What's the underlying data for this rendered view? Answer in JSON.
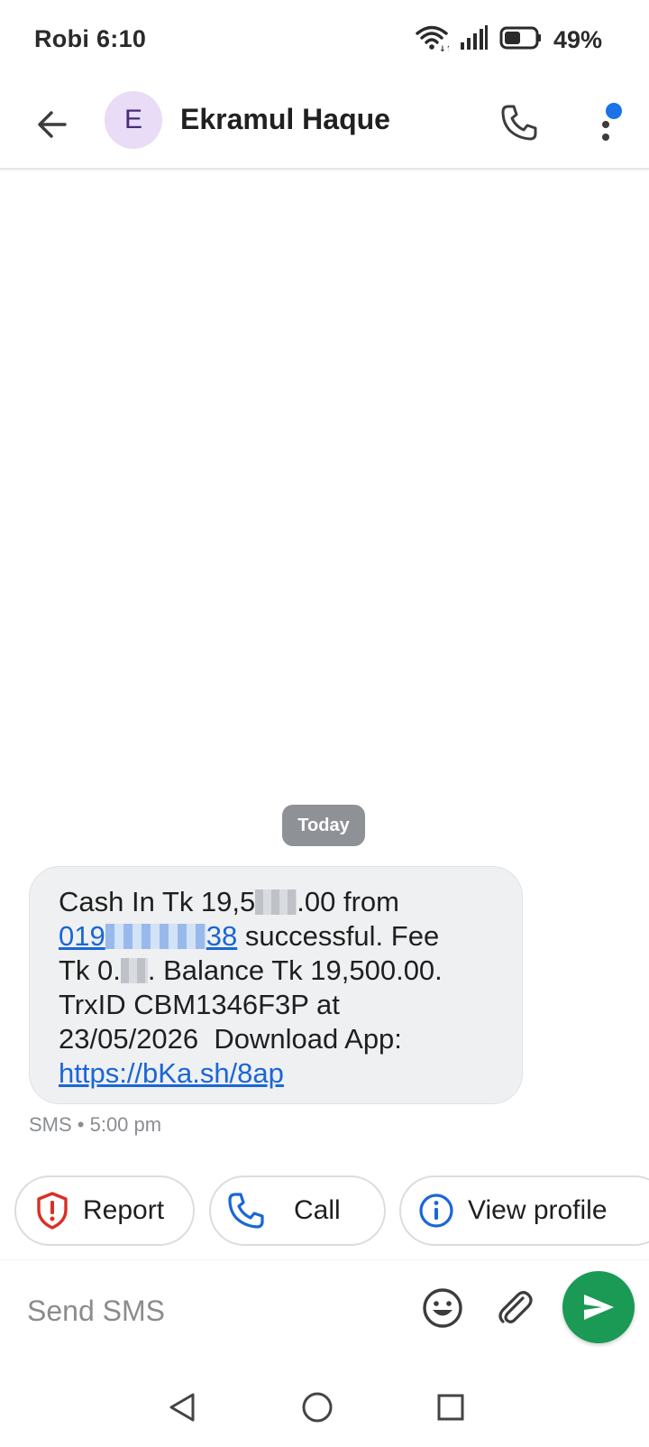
{
  "status_bar": {
    "carrier_time": "Robi 6:10",
    "battery_percent": "49%",
    "battery_level": 0.49,
    "icons": [
      "wifi-icon",
      "signal-icon",
      "battery-icon"
    ]
  },
  "app_bar": {
    "back_icon": "arrow-back-icon",
    "avatar_letter": "E",
    "contact_name": "Ekramul Haque",
    "call_icon": "phone-icon",
    "more_icon": "more-vert-icon",
    "notification_dot_color": "#1a73e8"
  },
  "conversation": {
    "date_label": "Today",
    "message": {
      "line1_a": "Cash In Tk 19,5",
      "line1_b": ".00 from",
      "line2_link_a": "019",
      "line2_link_b": "38",
      "line2_text": " successful. Fee",
      "line3_a": "Tk 0.",
      "line3_b": ". Balance Tk 19,500.00.",
      "line4": "TrxID CBM1346F3P at",
      "line5": "23/05/2026  Download App:",
      "line6_link": "https://bKa.sh/8ap"
    },
    "meta": "SMS • 5:00 pm"
  },
  "suggestions": [
    {
      "label": "Report",
      "icon": "report-shield-icon"
    },
    {
      "label": "Call",
      "icon": "phone-icon"
    },
    {
      "label": "View profile",
      "icon": "info-icon"
    }
  ],
  "composer": {
    "placeholder": "Send SMS",
    "emoji_icon": "emoji-icon",
    "attach_icon": "attach-icon",
    "send_icon": "send-icon",
    "send_color": "#1a9a55"
  },
  "nav_bar": {
    "icons": [
      "back-triangle-icon",
      "home-circle-icon",
      "recents-square-icon"
    ]
  }
}
